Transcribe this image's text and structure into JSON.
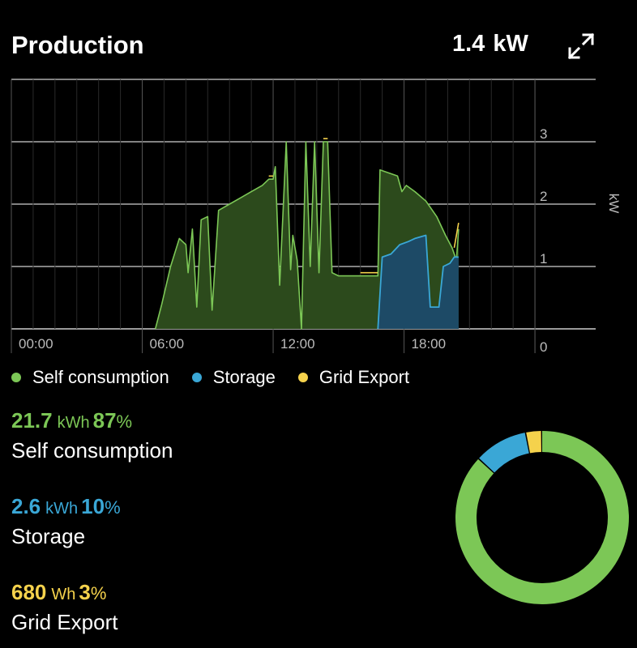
{
  "header": {
    "title": "Production",
    "power_value": "1.4",
    "power_unit": "kW"
  },
  "colors": {
    "self": "#7cc756",
    "storage": "#3aa7d6",
    "export": "#f5d24c",
    "self_fill": "#2c4a1c",
    "storage_fill": "#1d4a66",
    "grid": "#cfcfcf"
  },
  "chart_data": {
    "type": "area",
    "ylabel": "kW",
    "ylim": [
      0,
      4
    ],
    "yticks": [
      "0",
      "1",
      "2",
      "3",
      "4"
    ],
    "xlim": [
      0,
      24
    ],
    "xticks": [
      {
        "hour": 0,
        "label": "00:00"
      },
      {
        "hour": 6,
        "label": "06:00"
      },
      {
        "hour": 12,
        "label": "12:00"
      },
      {
        "hour": 18,
        "label": "18:00"
      }
    ],
    "series": [
      {
        "name": "Self consumption",
        "color": "self",
        "points": [
          [
            6.6,
            0
          ],
          [
            6.9,
            0.4
          ],
          [
            7.3,
            1.0
          ],
          [
            7.7,
            1.45
          ],
          [
            8.0,
            1.35
          ],
          [
            8.1,
            0.9
          ],
          [
            8.3,
            1.6
          ],
          [
            8.5,
            0.35
          ],
          [
            8.7,
            1.75
          ],
          [
            9.0,
            1.8
          ],
          [
            9.2,
            0.3
          ],
          [
            9.5,
            1.9
          ],
          [
            10.0,
            2.0
          ],
          [
            10.5,
            2.1
          ],
          [
            11.0,
            2.2
          ],
          [
            11.5,
            2.3
          ],
          [
            11.8,
            2.4
          ],
          [
            12.0,
            2.4
          ],
          [
            12.1,
            2.6
          ],
          [
            12.3,
            0.7
          ],
          [
            12.6,
            3.0
          ],
          [
            12.8,
            0.95
          ],
          [
            12.9,
            1.5
          ],
          [
            13.1,
            1.1
          ],
          [
            13.3,
            0.0
          ],
          [
            13.5,
            3.0
          ],
          [
            13.7,
            1.0
          ],
          [
            13.9,
            3.0
          ],
          [
            14.1,
            0.9
          ],
          [
            14.3,
            3.0
          ],
          [
            14.5,
            3.0
          ],
          [
            14.7,
            0.9
          ],
          [
            15.0,
            0.85
          ],
          [
            16.0,
            0.85
          ],
          [
            16.8,
            0.85
          ],
          [
            16.9,
            2.55
          ],
          [
            17.3,
            2.5
          ],
          [
            17.7,
            2.45
          ],
          [
            17.9,
            2.2
          ],
          [
            18.1,
            2.3
          ],
          [
            18.5,
            2.2
          ],
          [
            19.0,
            2.05
          ],
          [
            19.5,
            1.8
          ],
          [
            19.9,
            1.5
          ],
          [
            20.2,
            1.3
          ],
          [
            20.4,
            1.1
          ],
          [
            20.5,
            1.6
          ]
        ]
      },
      {
        "name": "Storage",
        "color": "storage",
        "points": [
          [
            16.8,
            0
          ],
          [
            17.0,
            1.15
          ],
          [
            17.4,
            1.2
          ],
          [
            17.8,
            1.35
          ],
          [
            18.2,
            1.4
          ],
          [
            18.5,
            1.45
          ],
          [
            19.0,
            1.5
          ],
          [
            19.2,
            0.35
          ],
          [
            19.6,
            0.35
          ],
          [
            19.8,
            1.0
          ],
          [
            20.1,
            1.05
          ],
          [
            20.3,
            1.15
          ],
          [
            20.5,
            1.15
          ]
        ]
      },
      {
        "name": "Grid Export",
        "color": "export",
        "points": [
          [
            11.8,
            2.45
          ],
          [
            12.0,
            2.45
          ],
          [
            14.3,
            3.05
          ],
          [
            14.5,
            3.05
          ],
          [
            16.0,
            0.9
          ],
          [
            16.8,
            0.9
          ],
          [
            20.3,
            1.3
          ],
          [
            20.5,
            1.7
          ]
        ]
      }
    ]
  },
  "legend": [
    {
      "label": "Self consumption",
      "color": "self"
    },
    {
      "label": "Storage",
      "color": "storage"
    },
    {
      "label": "Grid Export",
      "color": "export"
    }
  ],
  "stats": [
    {
      "value": "21.7",
      "unit": "kWh",
      "percent_num": "87",
      "percent_sym": "%",
      "label": "Self consumption",
      "color": "self"
    },
    {
      "value": "2.6",
      "unit": "kWh",
      "percent_num": "10",
      "percent_sym": "%",
      "label": "Storage",
      "color": "storage"
    },
    {
      "value": "680",
      "unit": "Wh",
      "percent_num": "3",
      "percent_sym": "%",
      "label": "Grid Export",
      "color": "export"
    }
  ],
  "donut": [
    {
      "name": "Self consumption",
      "percent": 87,
      "color": "self"
    },
    {
      "name": "Storage",
      "percent": 10,
      "color": "storage"
    },
    {
      "name": "Grid Export",
      "percent": 3,
      "color": "export"
    }
  ]
}
